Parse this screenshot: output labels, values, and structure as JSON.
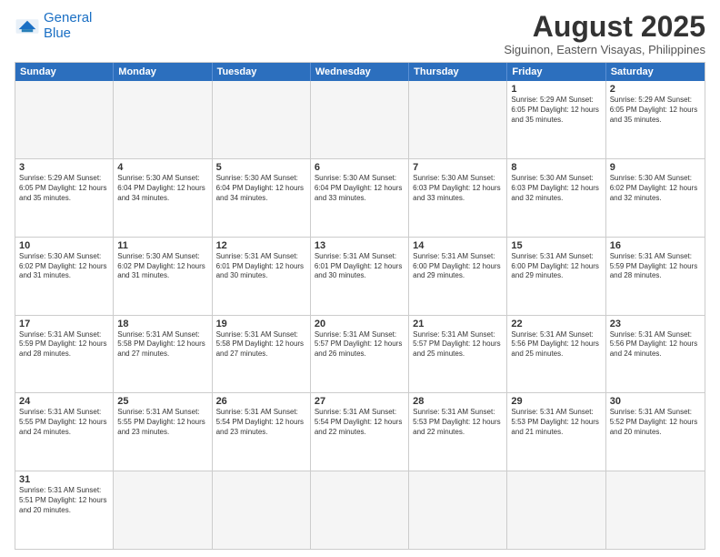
{
  "logo": {
    "line1": "General",
    "line2": "Blue"
  },
  "title": "August 2025",
  "subtitle": "Siguinon, Eastern Visayas, Philippines",
  "header_days": [
    "Sunday",
    "Monday",
    "Tuesday",
    "Wednesday",
    "Thursday",
    "Friday",
    "Saturday"
  ],
  "weeks": [
    [
      {
        "day": "",
        "info": ""
      },
      {
        "day": "",
        "info": ""
      },
      {
        "day": "",
        "info": ""
      },
      {
        "day": "",
        "info": ""
      },
      {
        "day": "",
        "info": ""
      },
      {
        "day": "1",
        "info": "Sunrise: 5:29 AM\nSunset: 6:05 PM\nDaylight: 12 hours and 35 minutes."
      },
      {
        "day": "2",
        "info": "Sunrise: 5:29 AM\nSunset: 6:05 PM\nDaylight: 12 hours and 35 minutes."
      }
    ],
    [
      {
        "day": "3",
        "info": "Sunrise: 5:29 AM\nSunset: 6:05 PM\nDaylight: 12 hours and 35 minutes."
      },
      {
        "day": "4",
        "info": "Sunrise: 5:30 AM\nSunset: 6:04 PM\nDaylight: 12 hours and 34 minutes."
      },
      {
        "day": "5",
        "info": "Sunrise: 5:30 AM\nSunset: 6:04 PM\nDaylight: 12 hours and 34 minutes."
      },
      {
        "day": "6",
        "info": "Sunrise: 5:30 AM\nSunset: 6:04 PM\nDaylight: 12 hours and 33 minutes."
      },
      {
        "day": "7",
        "info": "Sunrise: 5:30 AM\nSunset: 6:03 PM\nDaylight: 12 hours and 33 minutes."
      },
      {
        "day": "8",
        "info": "Sunrise: 5:30 AM\nSunset: 6:03 PM\nDaylight: 12 hours and 32 minutes."
      },
      {
        "day": "9",
        "info": "Sunrise: 5:30 AM\nSunset: 6:02 PM\nDaylight: 12 hours and 32 minutes."
      }
    ],
    [
      {
        "day": "10",
        "info": "Sunrise: 5:30 AM\nSunset: 6:02 PM\nDaylight: 12 hours and 31 minutes."
      },
      {
        "day": "11",
        "info": "Sunrise: 5:30 AM\nSunset: 6:02 PM\nDaylight: 12 hours and 31 minutes."
      },
      {
        "day": "12",
        "info": "Sunrise: 5:31 AM\nSunset: 6:01 PM\nDaylight: 12 hours and 30 minutes."
      },
      {
        "day": "13",
        "info": "Sunrise: 5:31 AM\nSunset: 6:01 PM\nDaylight: 12 hours and 30 minutes."
      },
      {
        "day": "14",
        "info": "Sunrise: 5:31 AM\nSunset: 6:00 PM\nDaylight: 12 hours and 29 minutes."
      },
      {
        "day": "15",
        "info": "Sunrise: 5:31 AM\nSunset: 6:00 PM\nDaylight: 12 hours and 29 minutes."
      },
      {
        "day": "16",
        "info": "Sunrise: 5:31 AM\nSunset: 5:59 PM\nDaylight: 12 hours and 28 minutes."
      }
    ],
    [
      {
        "day": "17",
        "info": "Sunrise: 5:31 AM\nSunset: 5:59 PM\nDaylight: 12 hours and 28 minutes."
      },
      {
        "day": "18",
        "info": "Sunrise: 5:31 AM\nSunset: 5:58 PM\nDaylight: 12 hours and 27 minutes."
      },
      {
        "day": "19",
        "info": "Sunrise: 5:31 AM\nSunset: 5:58 PM\nDaylight: 12 hours and 27 minutes."
      },
      {
        "day": "20",
        "info": "Sunrise: 5:31 AM\nSunset: 5:57 PM\nDaylight: 12 hours and 26 minutes."
      },
      {
        "day": "21",
        "info": "Sunrise: 5:31 AM\nSunset: 5:57 PM\nDaylight: 12 hours and 25 minutes."
      },
      {
        "day": "22",
        "info": "Sunrise: 5:31 AM\nSunset: 5:56 PM\nDaylight: 12 hours and 25 minutes."
      },
      {
        "day": "23",
        "info": "Sunrise: 5:31 AM\nSunset: 5:56 PM\nDaylight: 12 hours and 24 minutes."
      }
    ],
    [
      {
        "day": "24",
        "info": "Sunrise: 5:31 AM\nSunset: 5:55 PM\nDaylight: 12 hours and 24 minutes."
      },
      {
        "day": "25",
        "info": "Sunrise: 5:31 AM\nSunset: 5:55 PM\nDaylight: 12 hours and 23 minutes."
      },
      {
        "day": "26",
        "info": "Sunrise: 5:31 AM\nSunset: 5:54 PM\nDaylight: 12 hours and 23 minutes."
      },
      {
        "day": "27",
        "info": "Sunrise: 5:31 AM\nSunset: 5:54 PM\nDaylight: 12 hours and 22 minutes."
      },
      {
        "day": "28",
        "info": "Sunrise: 5:31 AM\nSunset: 5:53 PM\nDaylight: 12 hours and 22 minutes."
      },
      {
        "day": "29",
        "info": "Sunrise: 5:31 AM\nSunset: 5:53 PM\nDaylight: 12 hours and 21 minutes."
      },
      {
        "day": "30",
        "info": "Sunrise: 5:31 AM\nSunset: 5:52 PM\nDaylight: 12 hours and 20 minutes."
      }
    ],
    [
      {
        "day": "31",
        "info": "Sunrise: 5:31 AM\nSunset: 5:51 PM\nDaylight: 12 hours and 20 minutes."
      },
      {
        "day": "",
        "info": ""
      },
      {
        "day": "",
        "info": ""
      },
      {
        "day": "",
        "info": ""
      },
      {
        "day": "",
        "info": ""
      },
      {
        "day": "",
        "info": ""
      },
      {
        "day": "",
        "info": ""
      }
    ]
  ]
}
